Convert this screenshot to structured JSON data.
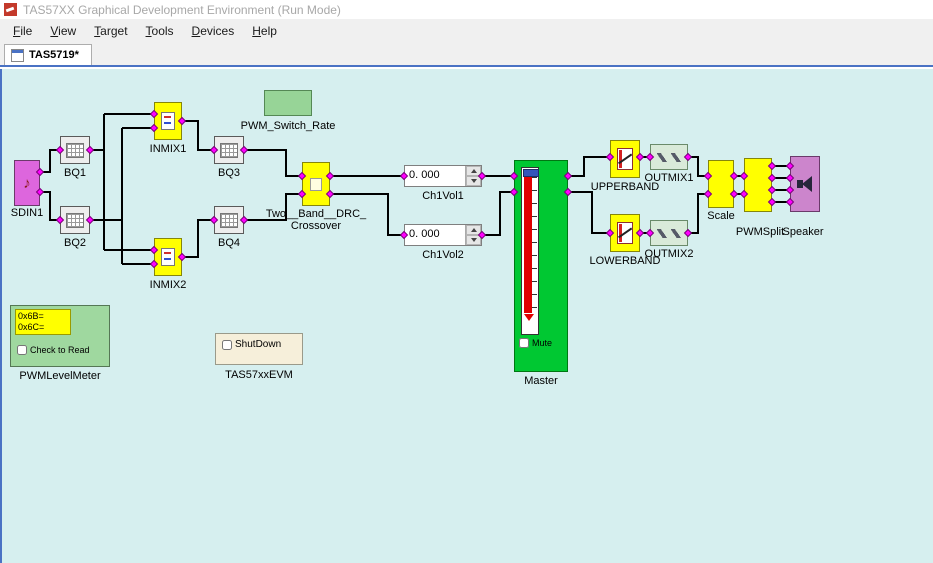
{
  "colors": {
    "canvas_bg": "#d6efef",
    "block_yellow": "#ffff00",
    "master_green": "#00c832",
    "meter_red": "#e00000",
    "accent_blue": "#4a72c4",
    "connector_magenta": "#ff00ff",
    "sdin_pink": "#dd66dd",
    "speaker_purple": "#cc85cc",
    "pwm_rate_green": "#97d497"
  },
  "window": {
    "title": "TAS57XX Graphical Development Environment (Run Mode)"
  },
  "menu": {
    "items": [
      "File",
      "View",
      "Target",
      "Tools",
      "Devices",
      "Help"
    ]
  },
  "tabs": {
    "active": "TAS5719*"
  },
  "icons": {
    "music_note": "♪"
  },
  "blocks": {
    "sdin1": {
      "label": "SDIN1",
      "icon": "music-note-icon"
    },
    "bq1": {
      "label": "BQ1",
      "icon": "biquad-grid-icon"
    },
    "bq2": {
      "label": "BQ2",
      "icon": "biquad-grid-icon"
    },
    "inmix1": {
      "label": "INMIX1",
      "icon": "mixer-icon"
    },
    "inmix2": {
      "label": "INMIX2",
      "icon": "mixer-icon"
    },
    "bq3": {
      "label": "BQ3",
      "icon": "biquad-grid-icon"
    },
    "bq4": {
      "label": "BQ4",
      "icon": "biquad-grid-icon"
    },
    "pwm_switch_rate": {
      "label": "PWM_Switch_Rate"
    },
    "crossover": {
      "label_line1": "Two__Band__DRC_",
      "label_line2": "Crossover"
    },
    "ch1vol1": {
      "label": "Ch1Vol1",
      "value": "0. 000"
    },
    "ch1vol2": {
      "label": "Ch1Vol2",
      "value": "0. 000"
    },
    "master": {
      "label": "Master",
      "mute_label": "Mute"
    },
    "upperband": {
      "label": "UPPERBAND",
      "icon": "drc-curve-icon"
    },
    "lowerband": {
      "label": "LOWERBAND",
      "icon": "drc-curve-icon"
    },
    "outmix1": {
      "label": "OUTMIX1",
      "icon": "outmix-icon"
    },
    "outmix2": {
      "label": "OUTMIX2",
      "icon": "outmix-icon"
    },
    "scale": {
      "label": "Scale"
    },
    "pwmsplit": {
      "label": "PWMSplit"
    },
    "speaker": {
      "label": "Speaker",
      "icon": "speaker-icon"
    },
    "pwm_level_meter": {
      "label": "PWMLevelMeter",
      "reg_a": "0x6B=",
      "reg_b": "0x6C=",
      "check_label": "Check to Read"
    },
    "tas57xx_evm": {
      "label": "TAS57xxEVM",
      "shutdown_label": "ShutDown"
    }
  }
}
